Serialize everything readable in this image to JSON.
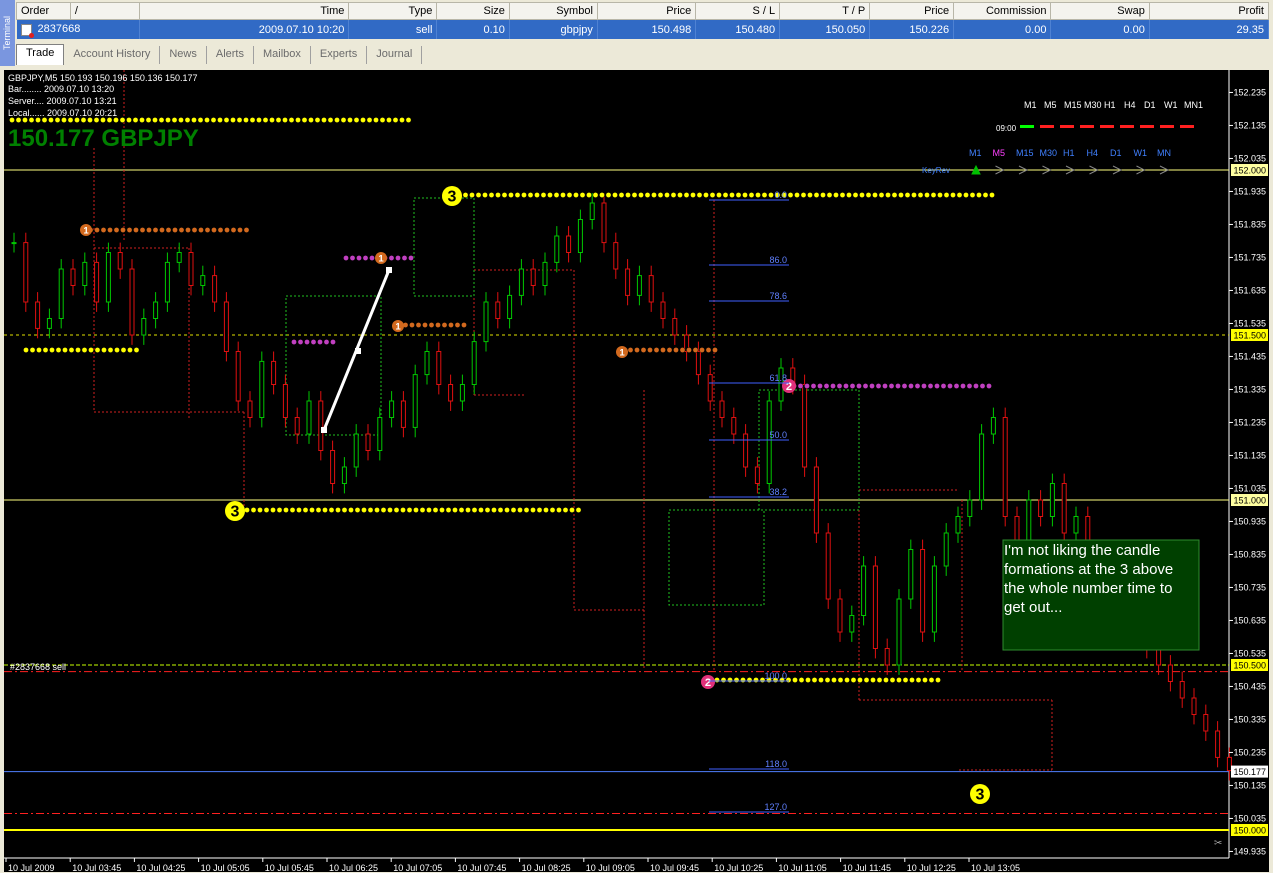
{
  "terminal": {
    "side_label": "Terminal",
    "columns": [
      "Order",
      "/",
      "Time",
      "Type",
      "Size",
      "Symbol",
      "Price",
      "S / L",
      "T / P",
      "Price",
      "Commission",
      "Swap",
      "Profit"
    ],
    "row": {
      "order": "2837668",
      "time": "2009.07.10 10:20",
      "type": "sell",
      "size": "0.10",
      "symbol": "gbpjpy",
      "price": "150.498",
      "sl": "150.480",
      "tp": "150.050",
      "current_price": "150.226",
      "commission": "0.00",
      "swap": "0.00",
      "profit": "29.35"
    },
    "tabs": [
      "Trade",
      "Account History",
      "News",
      "Alerts",
      "Mailbox",
      "Experts",
      "Journal"
    ],
    "active_tab": "Trade"
  },
  "chart": {
    "symbol_line": "GBPJPY,M5  150.193 150.196 150.136 150.177",
    "bar_line": "Bar........ 2009.07.10 13:20",
    "server_line": "Server.... 2009.07.10 13:21",
    "local_line": "Local...... 2009.07.10 20:21",
    "big_price": "150.177 GBPJPY",
    "order_label": "#2837668 sell",
    "timeframes_top": [
      "M1",
      "M5",
      "M15",
      "M30",
      "H1",
      "H4",
      "D1",
      "W1",
      "MN1"
    ],
    "time_label": "09:00",
    "timeframes_row": [
      "M1",
      "M5",
      "M15",
      "M30",
      "H1",
      "H4",
      "D1",
      "W1",
      "MN"
    ],
    "keyrev_label": "KeyRev",
    "note": [
      "I'm not liking the candle",
      "formations at the 3 above",
      "the whole number time to",
      "get out..."
    ],
    "fib_labels": [
      "0.0",
      "86.0",
      "78.6",
      "61.8",
      "50.0",
      "38.2",
      "100.0",
      "118.0",
      "127.0"
    ],
    "price_axis": [
      "152.235",
      "152.135",
      "152.035",
      "151.935",
      "151.835",
      "151.735",
      "151.635",
      "151.535",
      "151.435",
      "151.335",
      "151.235",
      "151.135",
      "151.035",
      "150.935",
      "150.835",
      "150.735",
      "150.635",
      "150.535",
      "150.435",
      "150.335",
      "150.235",
      "150.135",
      "150.035",
      "149.935"
    ],
    "price_tags": [
      "152.000",
      "151.500",
      "151.000",
      "150.500",
      "150.177",
      "150.000"
    ],
    "time_axis": [
      "10 Jul 2009",
      "10 Jul 03:45",
      "10 Jul 04:25",
      "10 Jul 05:05",
      "10 Jul 05:45",
      "10 Jul 06:25",
      "10 Jul 07:05",
      "10 Jul 07:45",
      "10 Jul 08:25",
      "10 Jul 09:05",
      "10 Jul 09:45",
      "10 Jul 10:25",
      "10 Jul 11:05",
      "10 Jul 11:45",
      "10 Jul 12:25",
      "10 Jul 13:05"
    ],
    "markers": [
      "3",
      "3",
      "3",
      "1",
      "1",
      "1",
      "1",
      "2",
      "2"
    ],
    "colors": {
      "bull": "#00c800",
      "bear": "#e01010",
      "grid": "#ffffff",
      "dots_yellow": "#ffff00",
      "dots_orange": "#d2691e",
      "dots_magenta": "#c040c0",
      "marker_yellow": "#ffff00",
      "note_bg": "#004000",
      "big_price": "#008000"
    }
  }
}
